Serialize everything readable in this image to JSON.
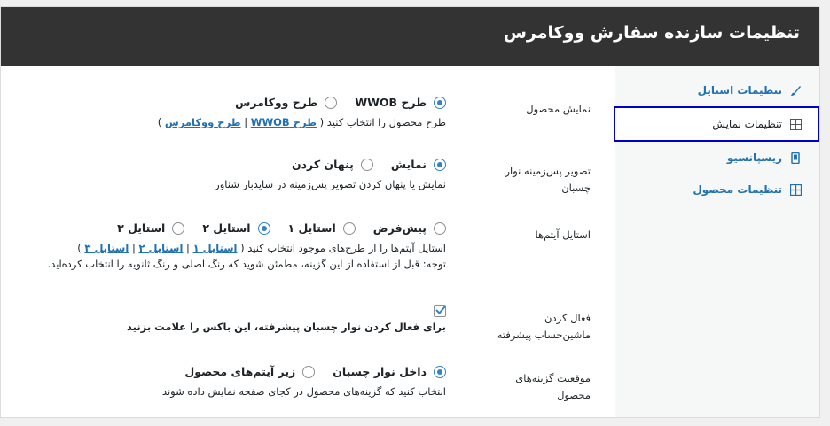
{
  "header": {
    "title": "تنظیمات سازنده سفارش ووکامرس"
  },
  "sidebar": {
    "items": [
      {
        "label": "تنظیمات استایل",
        "icon": "brush-icon"
      },
      {
        "label": "تنظیمات نمایش",
        "icon": "grid-icon",
        "active": true
      },
      {
        "label": "ریسپانسیو",
        "icon": "mobile-icon"
      },
      {
        "label": "تنظیمات محصول",
        "icon": "grid-icon"
      }
    ]
  },
  "settings": {
    "product_display": {
      "label": "نمایش محصول",
      "option1": "طرح WWOB",
      "option2": "طرح ووکامرس",
      "selected": "option1",
      "desc_prefix": "طرح محصول را انتخاب کنید (",
      "link1": "طرح WWOB",
      "sep": "|",
      "link2": "طرح ووکامرس",
      "desc_suffix": ")"
    },
    "sticky_bg": {
      "label": "تصویر پس‌زمینه نوار چسبان",
      "option1": "نمایش",
      "option2": "پنهان کردن",
      "selected": "option1",
      "desc": "نمایش یا پنهان کردن تصویر پس‌زمینه در سایدبار شناور"
    },
    "item_style": {
      "label": "استایل آیتم‌ها",
      "option1": "پیش‌فرض",
      "option2": "استایل ۱",
      "option3": "استایل ۲",
      "option4": "استایل ۳",
      "selected": "option3",
      "desc_prefix": "استایل آیتم‌ها را از طرح‌های موجود انتخاب کنید (",
      "link1": "استایل ۱",
      "sep1": "|",
      "link2": "استایل ۲",
      "sep2": "|",
      "link3": "استایل ۳",
      "desc_suffix": ")",
      "note": "توجه: قبل از استفاده از این گزینه، مطمئن شوید که رنگ اصلی و رنگ ثانویه را انتخاب کرده‌اید."
    },
    "calculator": {
      "label": "فعال کردن ماشین‌حساب پیشرفته",
      "checked": true,
      "desc": "برای فعال کردن نوار چسبان پیشرفته، این باکس را علامت بزنید"
    },
    "options_position": {
      "label": "موقعیت گزینه‌های محصول",
      "option1": "داخل نوار چسبان",
      "option2": "زیر آیتم‌های محصول",
      "selected": "option1",
      "desc": "انتخاب کنید که گزینه‌های محصول در کجای صفحه نمایش داده شوند"
    }
  },
  "colors": {
    "header_bg": "#333333",
    "accent": "#2271b1",
    "radio": "#3582c4"
  }
}
